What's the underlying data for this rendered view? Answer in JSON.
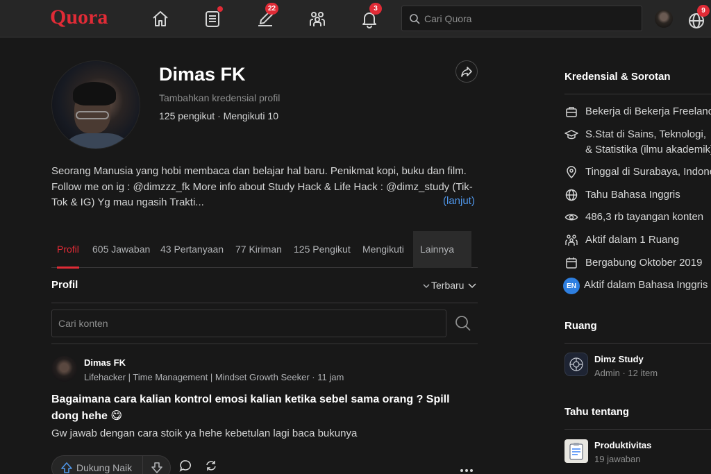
{
  "header": {
    "logo": "Quora",
    "search_placeholder": "Cari Quora",
    "icons": [
      "home-icon",
      "following-icon",
      "answer-icon",
      "spaces-icon",
      "notifications-icon",
      "search-icon",
      "language-icon"
    ],
    "answer_badge": "22",
    "notifications_badge": "3",
    "language_badge": "9",
    "accent_color": "#e02b36"
  },
  "profile": {
    "name": "Dimas FK",
    "credential_prompt": "Tambahkan kredensial profil",
    "follow_stats": "125 pengikut · Mengikuti 10",
    "bio": "Seorang Manusia yang hobi membaca dan belajar hal baru. Penikmat kopi, buku dan film. Follow me on ig : @dimzzz_fk More info about Study Hack & Life Hack : @dimz_study (Tik-Tok & IG) Yg mau ngasih Trakti...",
    "more_link": "(lanjut)"
  },
  "tabs": [
    {
      "label": "Profil",
      "active": true
    },
    {
      "label": "605 Jawaban"
    },
    {
      "label": "43 Pertanyaan"
    },
    {
      "label": "77 Kiriman"
    },
    {
      "label": "125 Pengikut"
    },
    {
      "label": "Mengikuti"
    },
    {
      "label": "Lainnya"
    }
  ],
  "feed": {
    "heading": "Profil",
    "sort_label": "Terbaru",
    "search_placeholder": "Cari konten"
  },
  "post": {
    "author": "Dimas FK",
    "meta": "Lifehacker | Time Management | Mindset Growth Seeker · 11 jam",
    "title": "Bagaimana cara kalian kontrol emosi kalian ketika sebel sama orang ? Spill dong hehe 😋",
    "body": "Gw jawab dengan cara stoik ya hehe kebetulan lagi baca bukunya",
    "upvote_label": "Dukung Naik"
  },
  "sidebar": {
    "credentials_title": "Kredensial & Sorotan",
    "credentials": [
      {
        "icon": "briefcase-icon",
        "text": "Bekerja di Bekerja Freelance"
      },
      {
        "icon": "graduation-cap-icon",
        "text": "S.Stat di Sains, Teknologi,",
        "text2": "& Statistika (ilmu akademik)"
      },
      {
        "icon": "location-pin-icon",
        "text": "Tinggal di Surabaya, Indonesia"
      },
      {
        "icon": "globe-icon",
        "text": "Tahu Bahasa Inggris"
      },
      {
        "icon": "eye-icon",
        "text": "486,3 rb tayangan konten"
      },
      {
        "icon": "spaces-icon",
        "text": "Aktif dalam 1 Ruang"
      },
      {
        "icon": "calendar-icon",
        "text": "Bergabung Oktober 2019"
      },
      {
        "icon": "en-badge",
        "badge": "EN",
        "text": "Aktif dalam Bahasa Inggris"
      }
    ],
    "spaces_title": "Ruang",
    "space": {
      "name": "Dimz Study",
      "meta": "Admin · 12 item"
    },
    "topics_title": "Tahu tentang",
    "topic": {
      "name": "Produktivitas",
      "meta": "19 jawaban"
    }
  }
}
